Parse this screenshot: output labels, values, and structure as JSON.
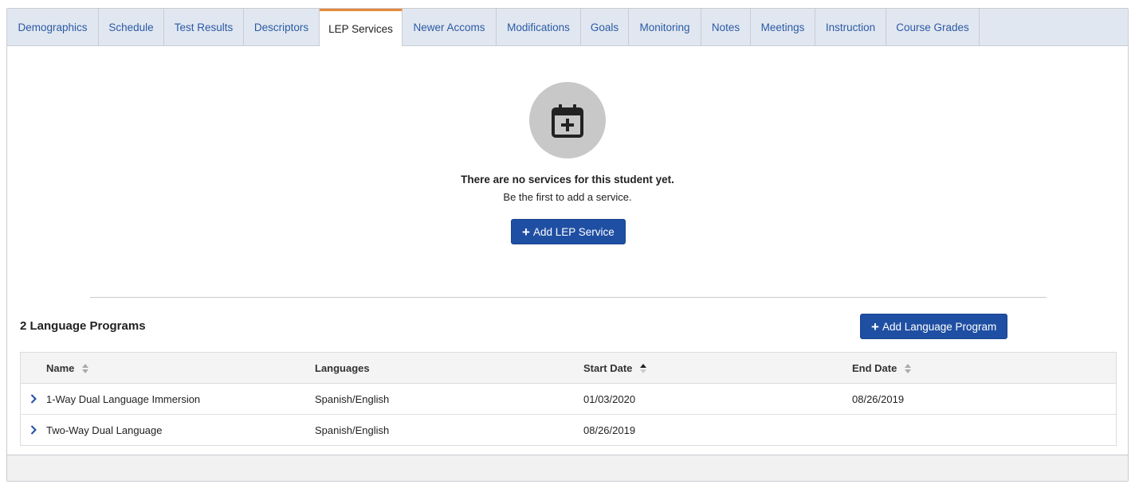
{
  "tabs": [
    {
      "label": "Demographics"
    },
    {
      "label": "Schedule"
    },
    {
      "label": "Test Results"
    },
    {
      "label": "Descriptors"
    },
    {
      "label": "LEP Services",
      "active": true
    },
    {
      "label": "Newer Accoms"
    },
    {
      "label": "Modifications"
    },
    {
      "label": "Goals"
    },
    {
      "label": "Monitoring"
    },
    {
      "label": "Notes"
    },
    {
      "label": "Meetings"
    },
    {
      "label": "Instruction"
    },
    {
      "label": "Course Grades"
    }
  ],
  "empty_state": {
    "icon": "calendar-plus-icon",
    "title": "There are no services for this student yet.",
    "subtitle": "Be the first to add a service.",
    "button_label": "Add LEP Service"
  },
  "programs": {
    "title": "2 Language Programs",
    "add_button_label": "Add Language Program",
    "columns": [
      "Name",
      "Languages",
      "Start Date",
      "End Date"
    ],
    "rows": [
      {
        "name": "1-Way Dual Language Immersion",
        "languages": "Spanish/English",
        "start_date": "01/03/2020",
        "end_date": "08/26/2019"
      },
      {
        "name": "Two-Way Dual Language",
        "languages": "Spanish/English",
        "start_date": "08/26/2019",
        "end_date": ""
      }
    ]
  },
  "colors": {
    "accent": "#1f4fa3",
    "active_tab_border": "#e8893a",
    "tab_text": "#2a5aa6",
    "tabbar_bg": "#e1e7f0"
  }
}
